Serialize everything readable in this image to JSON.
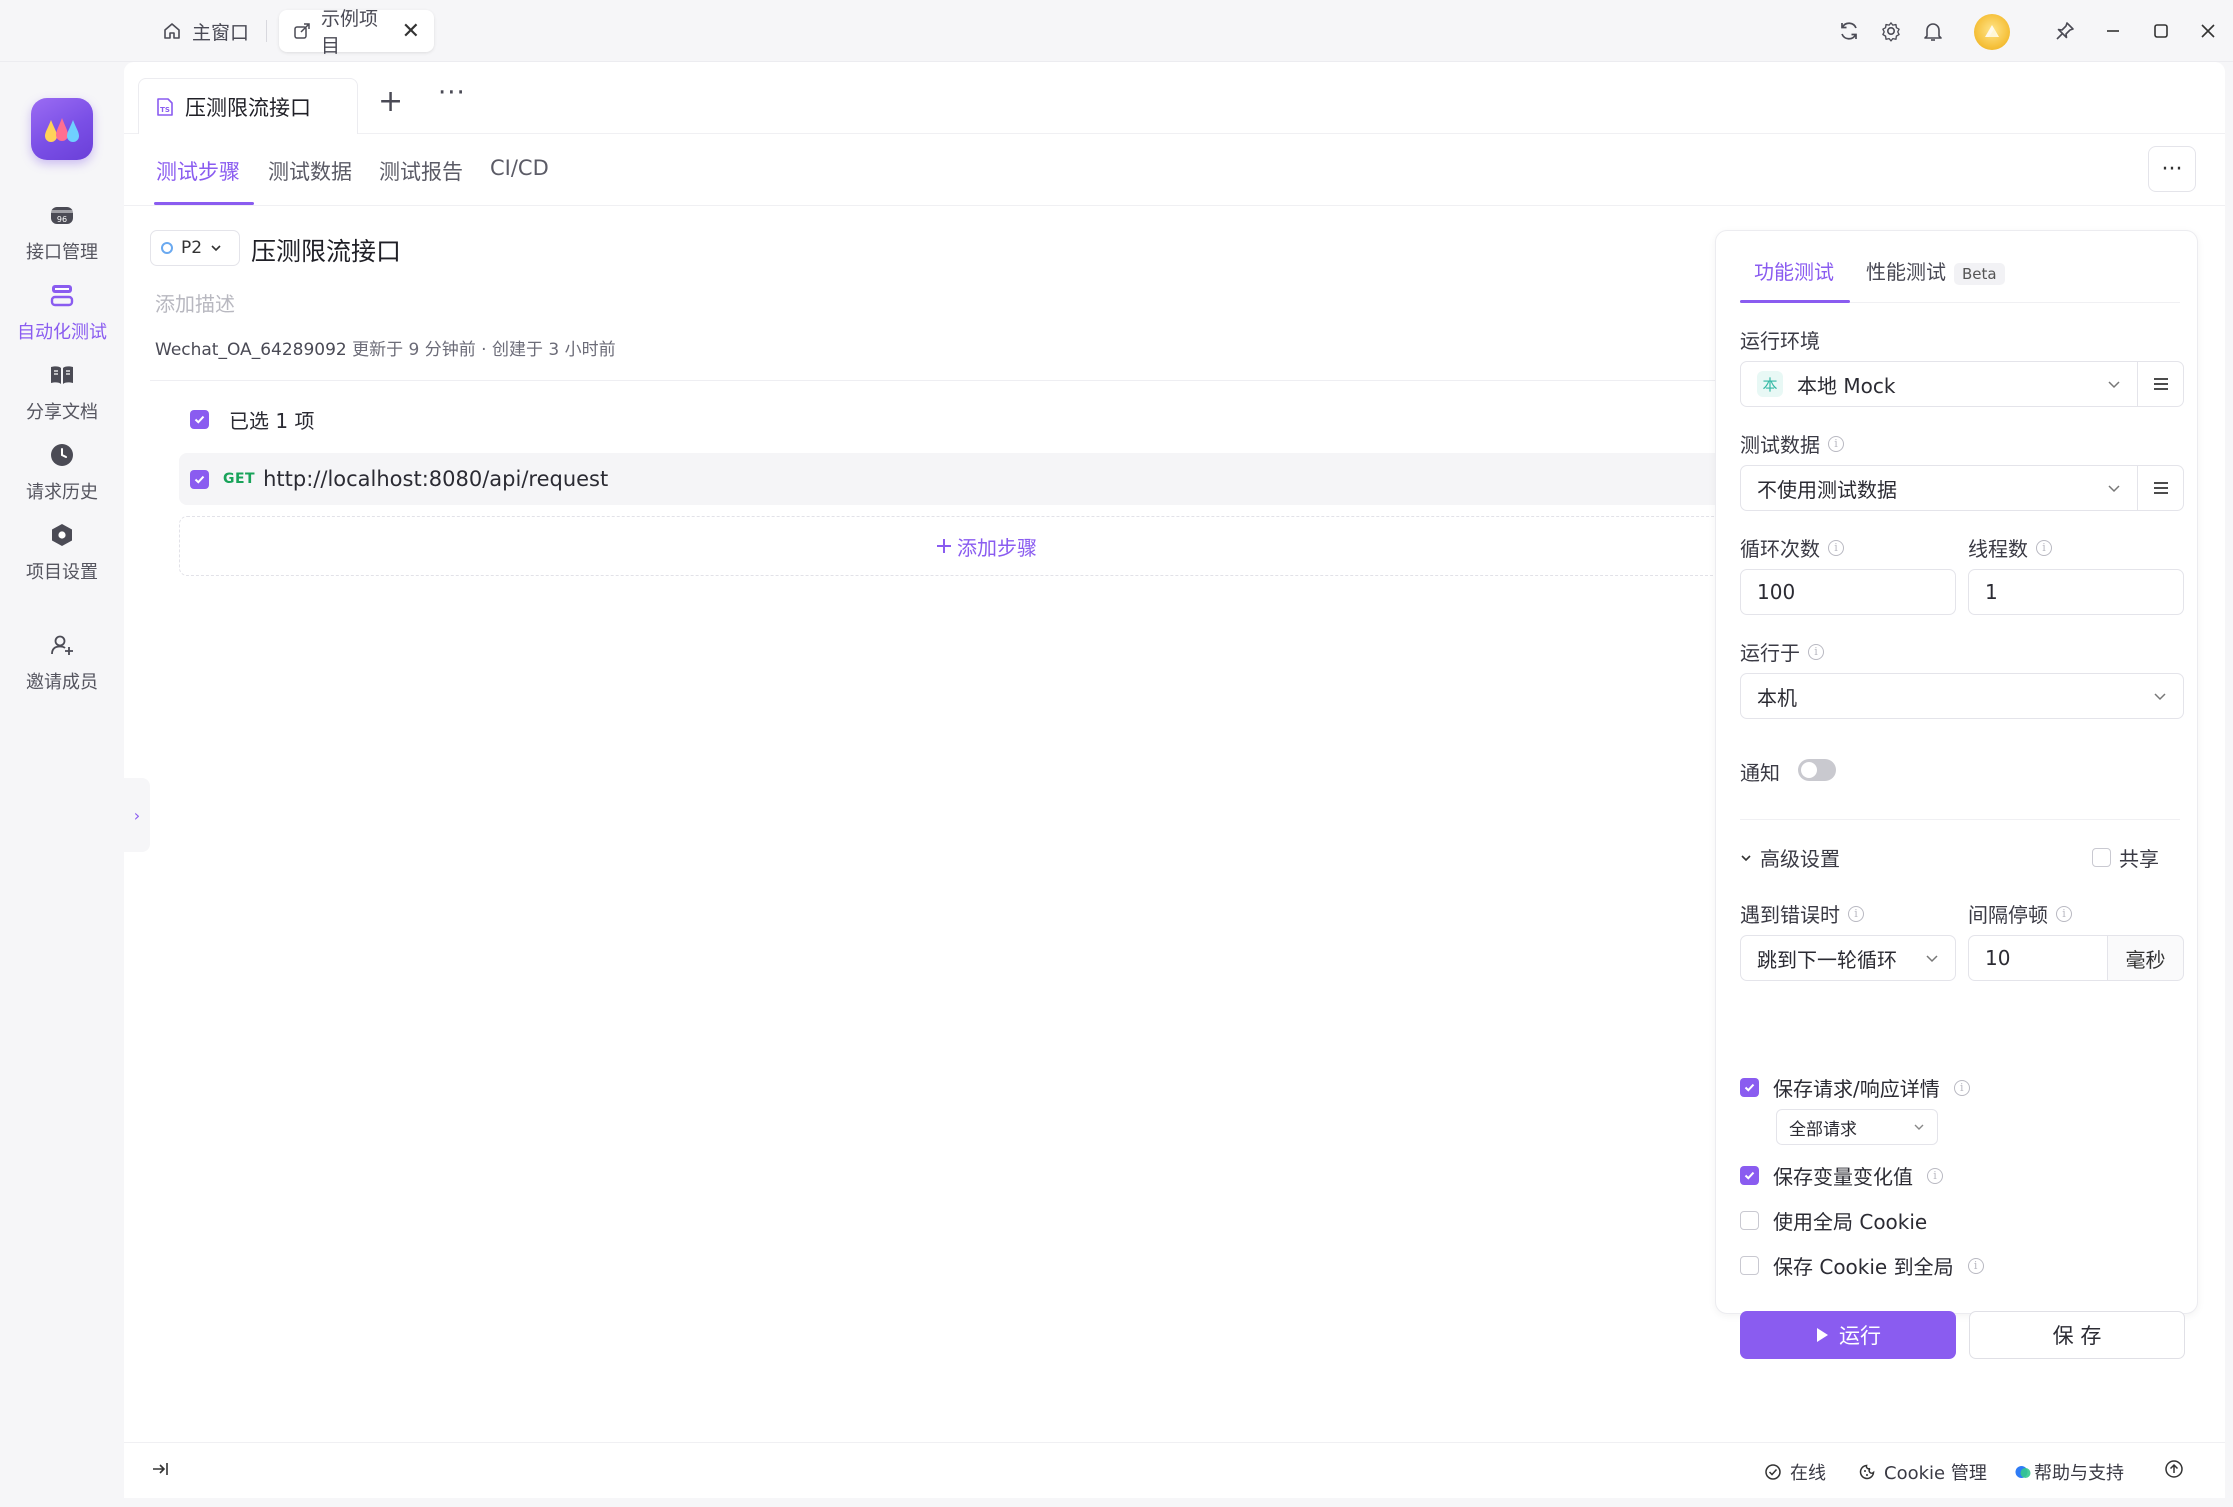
{
  "window": {
    "tabs": [
      {
        "label": "主窗口",
        "icon": "home-icon"
      },
      {
        "label": "示例项目",
        "icon": "external-link-icon",
        "close": "✕"
      }
    ],
    "toolbar_icons": [
      "refresh-icon",
      "settings-icon",
      "bell-icon",
      "avatar",
      "pin-icon",
      "minimize-icon",
      "maximize-icon",
      "close-icon"
    ]
  },
  "sidebar": {
    "items": [
      {
        "label": "接口管理",
        "icon": "api-icon"
      },
      {
        "label": "自动化测试",
        "icon": "automation-icon",
        "active": true
      },
      {
        "label": "分享文档",
        "icon": "book-icon"
      },
      {
        "label": "请求历史",
        "icon": "clock-icon"
      },
      {
        "label": "项目设置",
        "icon": "hexagon-settings-icon"
      },
      {
        "label": "邀请成员",
        "icon": "add-user-icon"
      }
    ]
  },
  "doc_tab": {
    "title": "压测限流接口"
  },
  "sub_tabs": [
    "测试步骤",
    "测试数据",
    "测试报告",
    "CI/CD"
  ],
  "case": {
    "priority": "P2",
    "title": "压测限流接口",
    "description_placeholder": "添加描述",
    "author": "Wechat_OA_64289092",
    "updated": "更新于 9 分钟前",
    "separator": "·",
    "created": "创建于 3 小时前"
  },
  "steps": {
    "selected_text": "已选 1 项",
    "items": [
      {
        "method": "GET",
        "url": "http://localhost:8080/api/request",
        "checked": true
      }
    ],
    "add_step_label": "添加步骤"
  },
  "run_panel": {
    "tabs": [
      {
        "label": "功能测试",
        "active": true
      },
      {
        "label": "性能测试",
        "badge": "Beta"
      }
    ],
    "env_label": "运行环境",
    "env_badge": "本",
    "env_value": "本地 Mock",
    "test_data_label": "测试数据",
    "test_data_value": "不使用测试数据",
    "loops_label": "循环次数",
    "loops_value": "100",
    "threads_label": "线程数",
    "threads_value": "1",
    "run_on_label": "运行于",
    "run_on_value": "本机",
    "notify_label": "通知",
    "notify_on": false,
    "advanced_label": "高级设置",
    "share_label": "共享",
    "on_error_label": "遇到错误时",
    "on_error_value": "跳到下一轮循环",
    "interval_label": "间隔停顿",
    "interval_value": "10",
    "interval_unit": "毫秒",
    "save_details_label": "保存请求/响应详情",
    "save_details_checked": true,
    "save_details_scope": "全部请求",
    "save_vars_label": "保存变量变化值",
    "save_vars_checked": true,
    "global_cookie_label": "使用全局 Cookie",
    "global_cookie_checked": false,
    "save_cookie_label": "保存 Cookie 到全局",
    "save_cookie_checked": false,
    "run_label": "运行",
    "save_label": "保 存"
  },
  "statusbar": {
    "online": "在线",
    "cookie": "Cookie 管理",
    "help": "帮助与支持"
  },
  "colors": {
    "accent": "#8a5cf0",
    "get_method": "#19a35a",
    "env_badge": "#32b8a4"
  }
}
